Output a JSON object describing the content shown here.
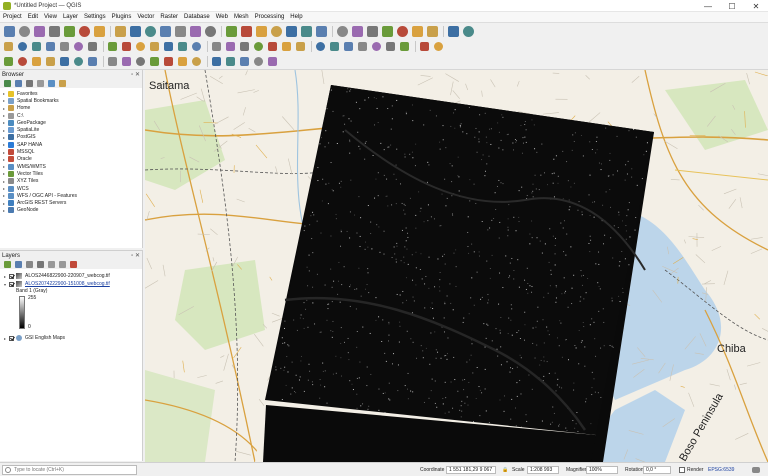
{
  "window": {
    "title": "*Untitled Project — QGIS",
    "controls": [
      "—",
      "☐",
      "✕"
    ]
  },
  "menubar": [
    "Project",
    "Edit",
    "View",
    "Layer",
    "Settings",
    "Plugins",
    "Vector",
    "Raster",
    "Database",
    "Web",
    "Mesh",
    "Processing",
    "Help"
  ],
  "toolbar_rows": [
    {
      "icons": [
        "new-project-icon",
        "open-project-icon",
        "save-project-icon",
        "save-as-icon",
        "print-layout-icon",
        "layout-manager-icon",
        "style-manager-icon",
        "pan-icon",
        "pan-to-selection-icon",
        "zoom-in-icon",
        "zoom-out-icon",
        "zoom-full-icon",
        "zoom-to-selection-icon",
        "zoom-to-layer-icon",
        "zoom-native-icon",
        "zoom-last-icon",
        "zoom-next-icon",
        "new-bookmark-icon",
        "show-bookmarks-icon",
        "temporal-controller-icon",
        "refresh-icon",
        "identify-icon",
        "select-feature-icon",
        "deselect-icon",
        "field-calculator-icon",
        "statistics-icon",
        "measure-icon",
        "annotation-icon",
        "map-tips-icon",
        "text-annotation-icon"
      ]
    },
    {
      "icons": [
        "data-source-manager-icon",
        "new-geopackage-layer-icon",
        "new-shapefile-icon",
        "new-virtual-layer-icon",
        "add-vector-layer-icon",
        "add-raster-layer-icon",
        "add-delimited-text-icon",
        "add-wms-layer-icon",
        "edit-pencil-icon",
        "edits-icon",
        "toggle-editing-icon",
        "save-edits-icon",
        "add-point-icon",
        "vertex-tool-icon",
        "delete-selected-icon",
        "cut-features-icon",
        "copy-features-icon",
        "paste-features-icon",
        "undo-icon",
        "redo-icon",
        "label-icon",
        "label-pin-icon",
        "label-highlight-icon",
        "label-show-hide-icon",
        "label-move-icon",
        "label-rotate-icon",
        "label-change-icon",
        "python-console-icon",
        "plugin-icon",
        "help-icon"
      ]
    },
    {
      "icons": [
        "digitize-icon",
        "split-features-icon",
        "merge-features-icon",
        "offset-curve-icon",
        "reshape-icon",
        "simplify-icon",
        "add-ring-icon",
        "add-part-icon",
        "fill-ring-icon",
        "delete-ring-icon",
        "delete-part-icon",
        "rotate-feature-icon",
        "scale-feature-icon",
        "georeferencer-icon",
        "processing-toolbox-icon",
        "graphical-modeler-icon",
        "history-icon",
        "results-viewer-icon",
        "circle-icon"
      ]
    }
  ],
  "browser": {
    "title": "Browser",
    "items": [
      {
        "label": "Favorites",
        "icon": "favorites-star-icon",
        "color": "#e6c229"
      },
      {
        "label": "Spatial Bookmarks",
        "icon": "bookmarks-icon",
        "color": "#7aa0c8"
      },
      {
        "label": "Home",
        "icon": "home-folder-icon",
        "color": "#c9a04a"
      },
      {
        "label": "C:\\",
        "icon": "drive-icon",
        "color": "#999999"
      },
      {
        "label": "GeoPackage",
        "icon": "geopackage-icon",
        "color": "#4b8bbf"
      },
      {
        "label": "SpatiaLite",
        "icon": "spatialite-icon",
        "color": "#6a9bd0"
      },
      {
        "label": "PostGIS",
        "icon": "postgis-icon",
        "color": "#3d6fa3"
      },
      {
        "label": "SAP HANA",
        "icon": "sap-hana-icon",
        "color": "#2b7bd6"
      },
      {
        "label": "MSSQL",
        "icon": "mssql-icon",
        "color": "#c14a3a"
      },
      {
        "label": "Oracle",
        "icon": "oracle-icon",
        "color": "#c44d3a"
      },
      {
        "label": "WMS/WMTS",
        "icon": "wms-icon",
        "color": "#5a8fc4"
      },
      {
        "label": "Vector Tiles",
        "icon": "vector-tiles-icon",
        "color": "#6b9a3a"
      },
      {
        "label": "XYZ Tiles",
        "icon": "xyz-tiles-icon",
        "color": "#8a8a8a"
      },
      {
        "label": "WCS",
        "icon": "wcs-icon",
        "color": "#5a8fc4"
      },
      {
        "label": "WFS / OGC API - Features",
        "icon": "wfs-icon",
        "color": "#5a8fc4"
      },
      {
        "label": "ArcGIS REST Servers",
        "icon": "arcgis-icon",
        "color": "#3f7fbf"
      },
      {
        "label": "GeoNode",
        "icon": "geonode-icon",
        "color": "#4a7ab0"
      }
    ]
  },
  "layers": {
    "title": "Layers",
    "items": [
      {
        "label": "ALOS2446822900-220907_webcog.tif",
        "selected": false
      },
      {
        "label": "ALOS2074222900-151008_webcog.tif",
        "selected": true
      },
      {
        "label": "GSI English Maps",
        "selected": false
      }
    ],
    "legend": {
      "band": "Band 1 (Gray)",
      "max": "255",
      "min": "0"
    }
  },
  "map": {
    "places": [
      "Saitama",
      "Chiba",
      "Boso Peninsula"
    ],
    "colors": {
      "base": "#f3efe6",
      "water": "#bcd5ea",
      "park": "#cfe3b4",
      "road": "#d9a13f",
      "rail": "#555555",
      "raster": "#0a0a0a"
    }
  },
  "statusbar": {
    "locator_placeholder": "Type to locate (Ctrl+K)",
    "coordinate_label": "Coordinate",
    "coordinate": "1 551 181,29 9 067",
    "scale_label": "Scale",
    "scale": "1:208 993",
    "magnifier_label": "Magnifier",
    "magnifier": "100%",
    "rotation_label": "Rotation",
    "rotation": "0,0 °",
    "render_label": "Render",
    "crs": "EPSG:6539"
  }
}
